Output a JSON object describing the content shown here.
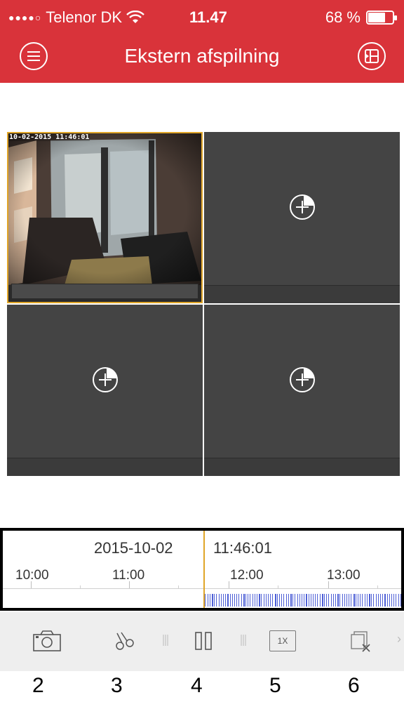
{
  "status_bar": {
    "signal_dots": "●●●●○",
    "carrier": "Telenor DK",
    "time": "11.47",
    "battery_text": "68 %",
    "battery_level": 0.68
  },
  "header": {
    "title": "Ekstern afspilning",
    "menu_icon": "hamburger-circle-icon",
    "layout_icon": "split-layout-icon",
    "color": "#d9333a"
  },
  "grid": {
    "cells": [
      {
        "timestamp": "10-02-2015 11:46:01",
        "state": "live-feed",
        "selected": true
      },
      {
        "state": "empty",
        "icon": "add-camera-icon"
      },
      {
        "state": "empty",
        "icon": "add-camera-icon"
      },
      {
        "state": "empty",
        "icon": "add-camera-icon"
      }
    ],
    "selected_border_color": "#e0a528"
  },
  "timeline": {
    "date": "2015-10-02",
    "time": "11:46:01",
    "labels": [
      "10:00",
      "11:00",
      "12:00",
      "13:00"
    ],
    "cursor_color": "#e0a528",
    "recording_color": "#4d5fd6"
  },
  "toolbar": {
    "snapshot_icon": "camera-icon",
    "clip_icon": "scissors-icon",
    "pause_icon": "pause-icon",
    "speed_label": "1X",
    "close_icon": "close-window-icon"
  },
  "callouts": [
    "2",
    "3",
    "4",
    "5",
    "6"
  ]
}
